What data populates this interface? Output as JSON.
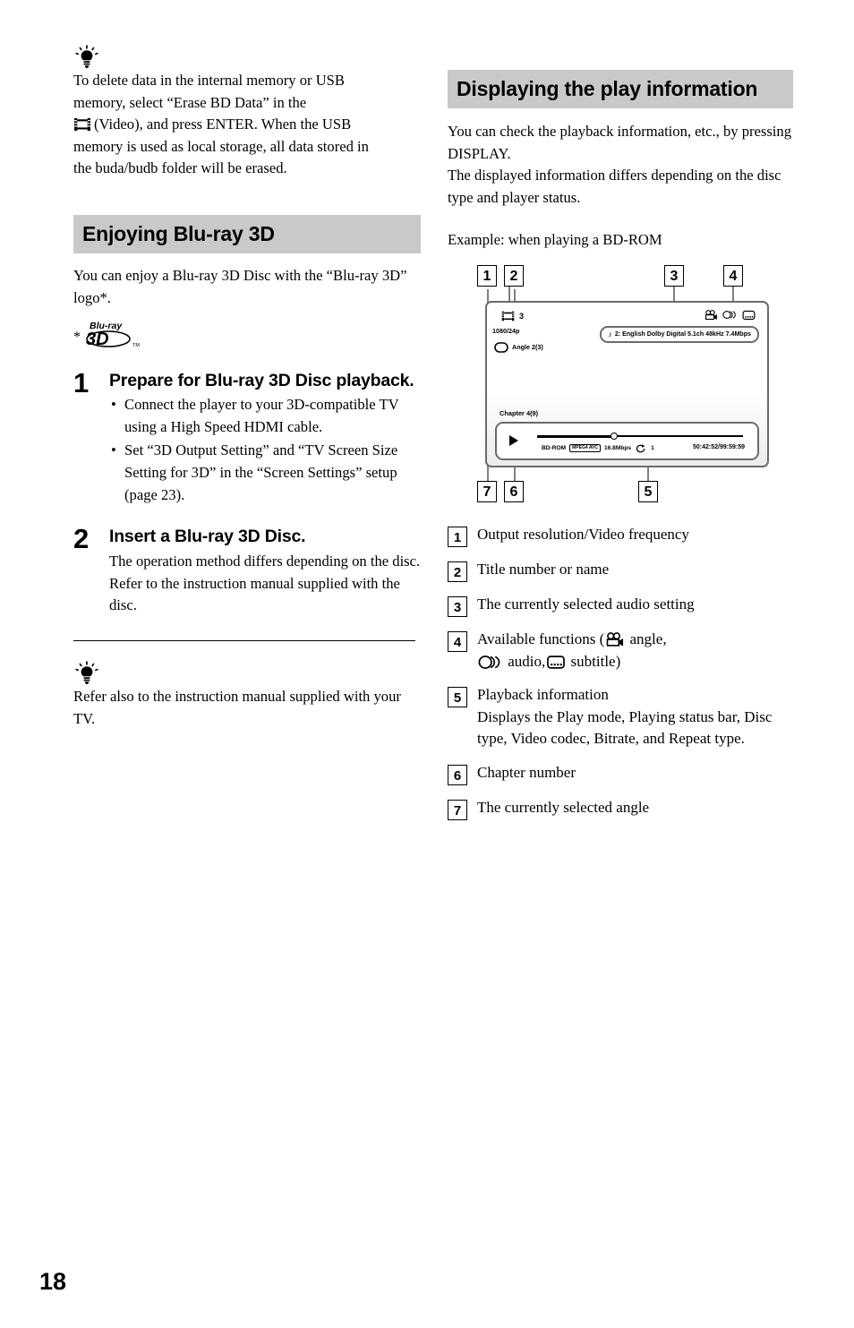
{
  "page": {
    "number": "18"
  },
  "left_column": {
    "tip_1": {
      "icon": "tip-bulb-icon",
      "text": "To delete data in the internal memory or USB memory, select “Erase BD Data” in the  (Video), and press ENTER. When the USB memory is used as local storage, all data stored in the buda/budb folder will be erased.",
      "line1": "To delete data in the internal memory or USB",
      "line2": "memory, select “Erase BD Data” in the",
      "line3_after_icon": "(Video), and press ENTER. When the USB",
      "line4": "memory is used as local storage, all data stored in",
      "line5": "the buda/budb folder will be erased."
    },
    "section": {
      "heading": "Enjoying Blu-ray 3D",
      "intro": "You can enjoy a Blu-ray 3D Disc with the “Blu-ray 3D” logo*.",
      "footnote_marker": "*",
      "logo": {
        "top": "Blu-ray",
        "bottom": "3D",
        "tm": "TM"
      }
    },
    "steps": [
      {
        "number": "1",
        "title": "Prepare for Blu-ray 3D Disc playback.",
        "bullets": [
          "Connect the player to your 3D-compatible TV using a High Speed HDMI cable.",
          "Set “3D Output Setting” and “TV Screen Size Setting for 3D” in the “Screen Settings” setup (page 23)."
        ]
      },
      {
        "number": "2",
        "title": "Insert a Blu-ray 3D Disc.",
        "text": "The operation method differs depending on the disc. Refer to the instruction manual supplied with the disc."
      }
    ],
    "tip_2": {
      "icon": "tip-bulb-icon",
      "text": "Refer also to the instruction manual supplied with your TV."
    }
  },
  "right_column": {
    "heading": "Displaying the play information",
    "intro_1": "You can check the playback information, etc., by pressing DISPLAY.",
    "intro_2": "The displayed information differs depending on the disc type and player status.",
    "example_caption": "Example: when playing a BD-ROM",
    "osd": {
      "title_number": "3",
      "output_resolution": "1080/24p",
      "angle": "Angle  2(3)",
      "audio_setting": "2: English Dolby Digital 5.1ch 48kHz   7.4Mbps",
      "icons": [
        "angle-icon",
        "audio-icon",
        "subtitle-icon"
      ],
      "chapter": "Chapter 4(9)",
      "play_mode": "play",
      "disc_type": "BD-ROM",
      "video_codec": "MPEG4 AVC",
      "bitrate": "16.8Mbps",
      "repeat_type": "1",
      "time": "50:42:52/99:59:59"
    },
    "callouts": [
      "1",
      "2",
      "3",
      "4",
      "5",
      "6",
      "7"
    ],
    "legend": [
      {
        "num": "1",
        "text": "Output resolution/Video frequency"
      },
      {
        "num": "2",
        "text": "Title number or name"
      },
      {
        "num": "3",
        "text": "The currently selected audio setting"
      },
      {
        "num": "4",
        "text": "Available functions (",
        "angle_label": " angle,",
        "audio_label": " audio,",
        "subtitle_label": " subtitle)"
      },
      {
        "num": "5",
        "text": "Playback information",
        "sub": "Displays the Play mode, Playing status bar, Disc type, Video codec, Bitrate, and Repeat type."
      },
      {
        "num": "6",
        "text": "Chapter number"
      },
      {
        "num": "7",
        "text": "The currently selected angle"
      }
    ]
  },
  "colors": {
    "header_bg": "#c9c9c9",
    "leader_line": "#808080",
    "screen_border": "#6b6b6b",
    "text": "#000000"
  }
}
